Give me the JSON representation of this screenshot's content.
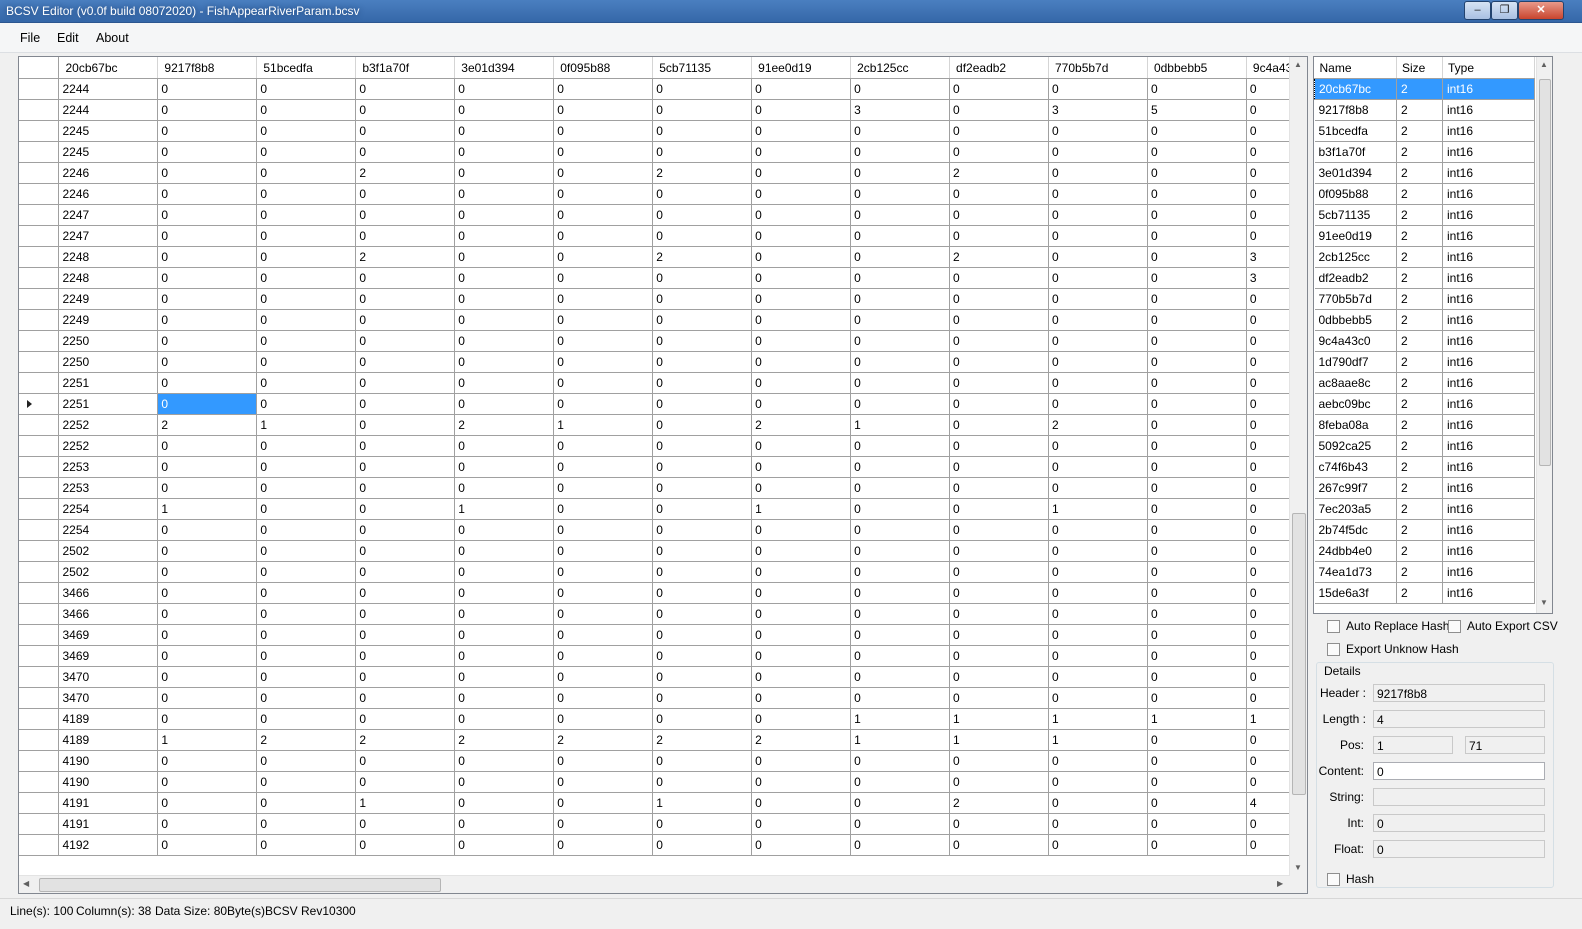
{
  "window": {
    "title": "BCSV Editor (v0.0f build 08072020) - FishAppearRiverParam.bcsv",
    "buttons": {
      "minimize": "‒",
      "maximize": "❐",
      "close": "✕"
    }
  },
  "menu": {
    "file": "File",
    "edit": "Edit",
    "about": "About"
  },
  "grid": {
    "columns": [
      "20cb67bc",
      "9217f8b8",
      "51bcedfa",
      "b3f1a70f",
      "3e01d394",
      "0f095b88",
      "5cb71135",
      "91ee0d19",
      "2cb125cc",
      "df2eadb2",
      "770b5b7d",
      "0dbbebb5",
      "9c4a43"
    ],
    "rows": [
      [
        "2244",
        "0",
        "0",
        "0",
        "0",
        "0",
        "0",
        "0",
        "0",
        "0",
        "0",
        "0",
        "0"
      ],
      [
        "2244",
        "0",
        "0",
        "0",
        "0",
        "0",
        "0",
        "0",
        "3",
        "0",
        "3",
        "5",
        "0"
      ],
      [
        "2245",
        "0",
        "0",
        "0",
        "0",
        "0",
        "0",
        "0",
        "0",
        "0",
        "0",
        "0",
        "0"
      ],
      [
        "2245",
        "0",
        "0",
        "0",
        "0",
        "0",
        "0",
        "0",
        "0",
        "0",
        "0",
        "0",
        "0"
      ],
      [
        "2246",
        "0",
        "0",
        "2",
        "0",
        "0",
        "2",
        "0",
        "0",
        "2",
        "0",
        "0",
        "0"
      ],
      [
        "2246",
        "0",
        "0",
        "0",
        "0",
        "0",
        "0",
        "0",
        "0",
        "0",
        "0",
        "0",
        "0"
      ],
      [
        "2247",
        "0",
        "0",
        "0",
        "0",
        "0",
        "0",
        "0",
        "0",
        "0",
        "0",
        "0",
        "0"
      ],
      [
        "2247",
        "0",
        "0",
        "0",
        "0",
        "0",
        "0",
        "0",
        "0",
        "0",
        "0",
        "0",
        "0"
      ],
      [
        "2248",
        "0",
        "0",
        "2",
        "0",
        "0",
        "2",
        "0",
        "0",
        "2",
        "0",
        "0",
        "3"
      ],
      [
        "2248",
        "0",
        "0",
        "0",
        "0",
        "0",
        "0",
        "0",
        "0",
        "0",
        "0",
        "0",
        "3"
      ],
      [
        "2249",
        "0",
        "0",
        "0",
        "0",
        "0",
        "0",
        "0",
        "0",
        "0",
        "0",
        "0",
        "0"
      ],
      [
        "2249",
        "0",
        "0",
        "0",
        "0",
        "0",
        "0",
        "0",
        "0",
        "0",
        "0",
        "0",
        "0"
      ],
      [
        "2250",
        "0",
        "0",
        "0",
        "0",
        "0",
        "0",
        "0",
        "0",
        "0",
        "0",
        "0",
        "0"
      ],
      [
        "2250",
        "0",
        "0",
        "0",
        "0",
        "0",
        "0",
        "0",
        "0",
        "0",
        "0",
        "0",
        "0"
      ],
      [
        "2251",
        "0",
        "0",
        "0",
        "0",
        "0",
        "0",
        "0",
        "0",
        "0",
        "0",
        "0",
        "0"
      ],
      [
        "2251",
        "0",
        "0",
        "0",
        "0",
        "0",
        "0",
        "0",
        "0",
        "0",
        "0",
        "0",
        "0"
      ],
      [
        "2252",
        "2",
        "1",
        "0",
        "2",
        "1",
        "0",
        "2",
        "1",
        "0",
        "2",
        "0",
        "0"
      ],
      [
        "2252",
        "0",
        "0",
        "0",
        "0",
        "0",
        "0",
        "0",
        "0",
        "0",
        "0",
        "0",
        "0"
      ],
      [
        "2253",
        "0",
        "0",
        "0",
        "0",
        "0",
        "0",
        "0",
        "0",
        "0",
        "0",
        "0",
        "0"
      ],
      [
        "2253",
        "0",
        "0",
        "0",
        "0",
        "0",
        "0",
        "0",
        "0",
        "0",
        "0",
        "0",
        "0"
      ],
      [
        "2254",
        "1",
        "0",
        "0",
        "1",
        "0",
        "0",
        "1",
        "0",
        "0",
        "1",
        "0",
        "0"
      ],
      [
        "2254",
        "0",
        "0",
        "0",
        "0",
        "0",
        "0",
        "0",
        "0",
        "0",
        "0",
        "0",
        "0"
      ],
      [
        "2502",
        "0",
        "0",
        "0",
        "0",
        "0",
        "0",
        "0",
        "0",
        "0",
        "0",
        "0",
        "0"
      ],
      [
        "2502",
        "0",
        "0",
        "0",
        "0",
        "0",
        "0",
        "0",
        "0",
        "0",
        "0",
        "0",
        "0"
      ],
      [
        "3466",
        "0",
        "0",
        "0",
        "0",
        "0",
        "0",
        "0",
        "0",
        "0",
        "0",
        "0",
        "0"
      ],
      [
        "3466",
        "0",
        "0",
        "0",
        "0",
        "0",
        "0",
        "0",
        "0",
        "0",
        "0",
        "0",
        "0"
      ],
      [
        "3469",
        "0",
        "0",
        "0",
        "0",
        "0",
        "0",
        "0",
        "0",
        "0",
        "0",
        "0",
        "0"
      ],
      [
        "3469",
        "0",
        "0",
        "0",
        "0",
        "0",
        "0",
        "0",
        "0",
        "0",
        "0",
        "0",
        "0"
      ],
      [
        "3470",
        "0",
        "0",
        "0",
        "0",
        "0",
        "0",
        "0",
        "0",
        "0",
        "0",
        "0",
        "0"
      ],
      [
        "3470",
        "0",
        "0",
        "0",
        "0",
        "0",
        "0",
        "0",
        "0",
        "0",
        "0",
        "0",
        "0"
      ],
      [
        "4189",
        "0",
        "0",
        "0",
        "0",
        "0",
        "0",
        "0",
        "1",
        "1",
        "1",
        "1",
        "1"
      ],
      [
        "4189",
        "1",
        "2",
        "2",
        "2",
        "2",
        "2",
        "2",
        "1",
        "1",
        "1",
        "0",
        "0"
      ],
      [
        "4190",
        "0",
        "0",
        "0",
        "0",
        "0",
        "0",
        "0",
        "0",
        "0",
        "0",
        "0",
        "0"
      ],
      [
        "4190",
        "0",
        "0",
        "0",
        "0",
        "0",
        "0",
        "0",
        "0",
        "0",
        "0",
        "0",
        "0"
      ],
      [
        "4191",
        "0",
        "0",
        "1",
        "0",
        "0",
        "1",
        "0",
        "0",
        "2",
        "0",
        "0",
        "4"
      ],
      [
        "4191",
        "0",
        "0",
        "0",
        "0",
        "0",
        "0",
        "0",
        "0",
        "0",
        "0",
        "0",
        "0"
      ],
      [
        "4192",
        "0",
        "0",
        "0",
        "0",
        "0",
        "0",
        "0",
        "0",
        "0",
        "0",
        "0",
        "0"
      ]
    ],
    "current_row_index": 15,
    "selected_column_index": 1
  },
  "fields": {
    "headers": {
      "name": "Name",
      "size": "Size",
      "type": "Type"
    },
    "items": [
      {
        "name": "20cb67bc",
        "size": "2",
        "type": "int16"
      },
      {
        "name": "9217f8b8",
        "size": "2",
        "type": "int16"
      },
      {
        "name": "51bcedfa",
        "size": "2",
        "type": "int16"
      },
      {
        "name": "b3f1a70f",
        "size": "2",
        "type": "int16"
      },
      {
        "name": "3e01d394",
        "size": "2",
        "type": "int16"
      },
      {
        "name": "0f095b88",
        "size": "2",
        "type": "int16"
      },
      {
        "name": "5cb71135",
        "size": "2",
        "type": "int16"
      },
      {
        "name": "91ee0d19",
        "size": "2",
        "type": "int16"
      },
      {
        "name": "2cb125cc",
        "size": "2",
        "type": "int16"
      },
      {
        "name": "df2eadb2",
        "size": "2",
        "type": "int16"
      },
      {
        "name": "770b5b7d",
        "size": "2",
        "type": "int16"
      },
      {
        "name": "0dbbebb5",
        "size": "2",
        "type": "int16"
      },
      {
        "name": "9c4a43c0",
        "size": "2",
        "type": "int16"
      },
      {
        "name": "1d790df7",
        "size": "2",
        "type": "int16"
      },
      {
        "name": "ac8aae8c",
        "size": "2",
        "type": "int16"
      },
      {
        "name": "aebc09bc",
        "size": "2",
        "type": "int16"
      },
      {
        "name": "8feba08a",
        "size": "2",
        "type": "int16"
      },
      {
        "name": "5092ca25",
        "size": "2",
        "type": "int16"
      },
      {
        "name": "c74f6b43",
        "size": "2",
        "type": "int16"
      },
      {
        "name": "267c99f7",
        "size": "2",
        "type": "int16"
      },
      {
        "name": "7ec203a5",
        "size": "2",
        "type": "int16"
      },
      {
        "name": "2b74f5dc",
        "size": "2",
        "type": "int16"
      },
      {
        "name": "24dbb4e0",
        "size": "2",
        "type": "int16"
      },
      {
        "name": "74ea1d73",
        "size": "2",
        "type": "int16"
      },
      {
        "name": "15de6a3f",
        "size": "2",
        "type": "int16"
      }
    ],
    "selected_index": 0
  },
  "options": {
    "auto_replace_hash": "Auto Replace Hash",
    "auto_export_csv": "Auto Export CSV",
    "export_unknown_hash": "Export Unknow Hash"
  },
  "details": {
    "title": "Details",
    "header_label": "Header :",
    "header_value": "9217f8b8",
    "length_label": "Length :",
    "length_value": "4",
    "pos_label": "Pos:",
    "pos_value1": "1",
    "pos_value2": "71",
    "content_label": "Content:",
    "content_value": "0",
    "string_label": "String:",
    "string_value": "",
    "int_label": "Int:",
    "int_value": "0",
    "float_label": "Float:",
    "float_value": "0",
    "hash_label": "Hash"
  },
  "status": {
    "lines": "Line(s): 100",
    "columns": "Column(s): 38",
    "data_size": "Data Size: 80Byte(s)",
    "revision": "BCSV Rev10300"
  },
  "colors": {
    "selection": "#3399ff",
    "titlebar": "#3567a8"
  }
}
